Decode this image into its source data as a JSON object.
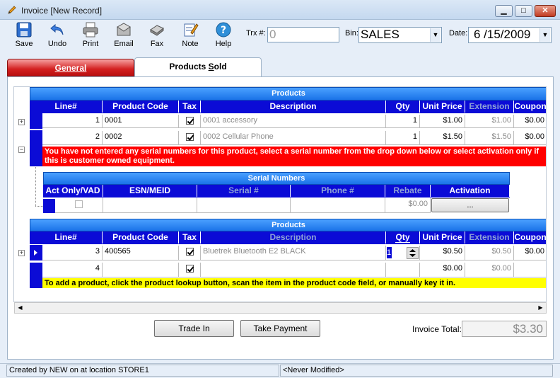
{
  "window": {
    "title": "Invoice [New Record]"
  },
  "toolbar": {
    "save": "Save",
    "undo": "Undo",
    "print": "Print",
    "email": "Email",
    "fax": "Fax",
    "note": "Note",
    "help": "Help"
  },
  "header": {
    "trx_label": "Trx #:",
    "trx_value": "0",
    "bin_label": "Bin:",
    "bin_value": "SALES",
    "date_label": "Date:",
    "date_value": "6 /15/2009"
  },
  "tabs": {
    "general": "General",
    "products_sold_pre": "Products ",
    "products_sold_u": "S",
    "products_sold_post": "old"
  },
  "products_band_1": {
    "title": "Products",
    "columns": [
      "Line#",
      "Product Code",
      "Tax",
      "Description",
      "Qty",
      "Unit Price",
      "Extension",
      "Coupon"
    ],
    "rows": [
      {
        "line": "1",
        "code": "0001",
        "taxed": true,
        "description": "0001 accessory",
        "qty": "1",
        "unit_price": "$1.00",
        "extension": "$1.00",
        "coupon": "$0.00"
      },
      {
        "line": "2",
        "code": "0002",
        "taxed": true,
        "description": "0002 Cellular Phone",
        "qty": "1",
        "unit_price": "$1.50",
        "extension": "$1.50",
        "coupon": "$0.00"
      }
    ],
    "warning": "You have not entered any serial numbers for this product, select a serial number from the drop down below or select activation only if this is customer owned equipment."
  },
  "serial_numbers": {
    "title": "Serial Numbers",
    "columns": [
      "Act Only/VAD",
      "ESN/MEID",
      "Serial #",
      "Phone #",
      "Rebate",
      "Activation"
    ],
    "row": {
      "act_only": false,
      "esn": "",
      "serial": "",
      "phone": "",
      "rebate": "$0.00",
      "activation_button": "..."
    }
  },
  "products_band_2": {
    "title": "Products",
    "columns": [
      "Line#",
      "Product Code",
      "Tax",
      "Description",
      "Qty",
      "Unit Price",
      "Extension",
      "Coupon"
    ],
    "rows": [
      {
        "line": "3",
        "code": "400565",
        "taxed": true,
        "description": "Bluetrek Bluetooth E2 BLACK",
        "qty": "1",
        "unit_price": "$0.50",
        "extension": "$0.50",
        "coupon": "$0.00"
      },
      {
        "line": "4",
        "code": "",
        "taxed": true,
        "description": "",
        "qty": "",
        "unit_price": "$0.00",
        "extension": "$0.00",
        "coupon": ""
      }
    ],
    "hint": "To add a product, click the product lookup button, scan the item in the product code field, or manually key it in."
  },
  "footer": {
    "trade_in": "Trade In",
    "take_payment": "Take Payment",
    "invoice_total_label": "Invoice Total:",
    "invoice_total_value": "$3.30"
  },
  "status": {
    "created": "Created by NEW on  at location STORE1",
    "modified": "<Never Modified>"
  }
}
